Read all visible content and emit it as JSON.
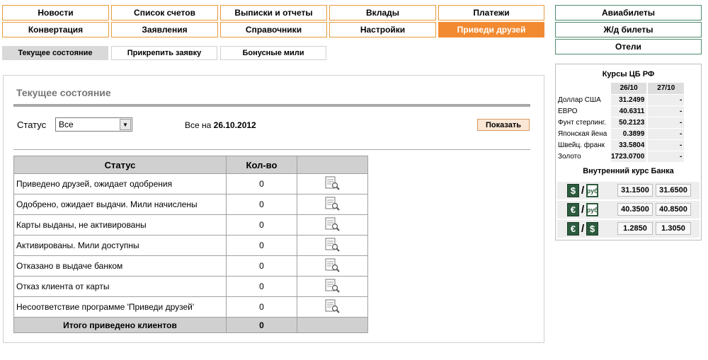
{
  "nav": {
    "row1": [
      "Новости",
      "Список счетов",
      "Выписки и отчеты",
      "Вклады",
      "Платежи"
    ],
    "row2": [
      "Конвертация",
      "Заявления",
      "Справочники",
      "Настройки",
      "Приведи друзей"
    ],
    "active": "Приведи друзей"
  },
  "travel": {
    "items": [
      "Авиабилеты",
      "Ж/д билеты",
      "Отели"
    ]
  },
  "subtabs": {
    "items": [
      "Текущее состояние",
      "Прикрепить заявку",
      "Бонусные мили"
    ],
    "active": "Текущее состояние"
  },
  "panel": {
    "title": "Текущее состояние",
    "filter_label": "Статус",
    "select_value": "Все",
    "asof_label": "Все на",
    "asof_date": "26.10.2012",
    "show_button": "Показать"
  },
  "table": {
    "headers": [
      "Статус",
      "Кол-во",
      ""
    ],
    "rows": [
      {
        "status": "Приведено друзей, ожидает одобрения",
        "count": "0"
      },
      {
        "status": "Одобрено, ожидает выдачи. Мили начислены",
        "count": "0"
      },
      {
        "status": "Карты выданы, не активированы",
        "count": "0"
      },
      {
        "status": "Активированы. Мили доступны",
        "count": "0"
      },
      {
        "status": "Отказано в выдаче банком",
        "count": "0"
      },
      {
        "status": "Отказ клиента от карты",
        "count": "0"
      },
      {
        "status": "Несоответствие программе 'Приведи друзей'",
        "count": "0"
      }
    ],
    "total_label": "Итого приведено клиентов",
    "total_count": "0"
  },
  "rates": {
    "title": "Курсы ЦБ РФ",
    "dates": [
      "26/10",
      "27/10"
    ],
    "rows": [
      {
        "name": "Доллар США",
        "d1": "31.2499",
        "d2": "-"
      },
      {
        "name": "ЕВРО",
        "d1": "40.6311",
        "d2": "-"
      },
      {
        "name": "Фунт стерлинг.",
        "d1": "50.2123",
        "d2": "-"
      },
      {
        "name": "Японская йена",
        "d1": "0.3899",
        "d2": "-"
      },
      {
        "name": "Швейц. франк",
        "d1": "33.5804",
        "d2": "-"
      },
      {
        "name": "Золото",
        "d1": "1723.0700",
        "d2": "-"
      }
    ],
    "inner_title": "Внутренний курс Банка",
    "bank": [
      {
        "from": "$",
        "to": "руб",
        "buy": "31.1500",
        "sell": "31.6500"
      },
      {
        "from": "€",
        "to": "руб",
        "buy": "40.3500",
        "sell": "40.8500"
      },
      {
        "from": "€",
        "to": "$",
        "buy": "1.2850",
        "sell": "1.3050"
      }
    ]
  },
  "colors": {
    "accent": "#f28a32",
    "nav_border": "#e69a3c",
    "green": "#2c5b3e",
    "header_gray": "#d0d0d0"
  }
}
